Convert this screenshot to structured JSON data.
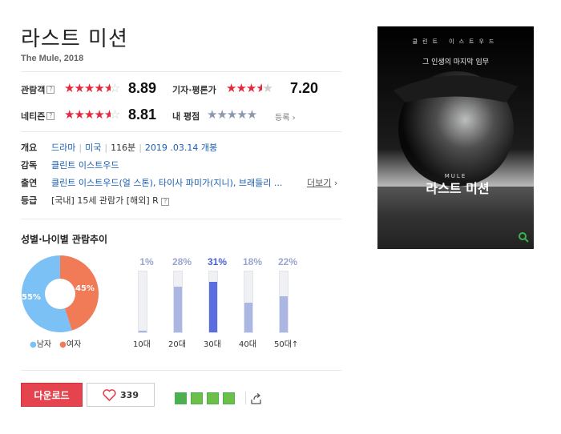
{
  "movie": {
    "title": "라스트 미션",
    "original": "The Mule, 2018"
  },
  "ratings": {
    "audience": {
      "label": "관람객",
      "score": "8.89",
      "stars": 4.5
    },
    "critics": {
      "label": "기자·평론가",
      "score": "7.20",
      "stars": 3.5
    },
    "netizen": {
      "label": "네티즌",
      "score": "8.81",
      "stars": 4.5
    },
    "mine": {
      "label": "내 평점",
      "action": "등록"
    }
  },
  "info": {
    "overview_label": "개요",
    "genre": "드라마",
    "country": "미국",
    "runtime": "116분",
    "release": "2019 .03.14 개봉",
    "director_label": "감독",
    "director": "클린트 이스트우드",
    "cast_label": "출연",
    "cast": "클린트 이스트우드(얼 스톤), 타이사 파미가(지니), 브래들리 ...",
    "more": "더보기",
    "grade_label": "등급",
    "grade": "[국내] 15세 관람가 [해외] R"
  },
  "trend": {
    "title": "성별·나이별 관람추이",
    "gender": {
      "male_pct": 55,
      "female_pct": 45,
      "male_label": "55%",
      "female_label": "45%",
      "legend_male": "남자",
      "legend_female": "여자"
    },
    "ages": [
      {
        "label": "10대",
        "pct_text": "1%",
        "value": 1
      },
      {
        "label": "20대",
        "pct_text": "28%",
        "value": 28
      },
      {
        "label": "30대",
        "pct_text": "31%",
        "value": 31,
        "highlight": true
      },
      {
        "label": "40대",
        "pct_text": "18%",
        "value": 18
      },
      {
        "label": "50대↑",
        "pct_text": "22%",
        "value": 22
      }
    ]
  },
  "actions": {
    "download": "다운로드",
    "likes": "339"
  },
  "poster": {
    "top_text": "클린트 이스트우드",
    "tagline": "그 인생의 마지막 임무",
    "en_title": "MULE",
    "ko_title": "라스트 미션"
  },
  "colors": {
    "red_star": "#e5293c",
    "male": "#7cc1f5",
    "female": "#f27b57",
    "bar": "#aab7e3",
    "bar_hi": "#5b6ee1",
    "download": "#e5444f"
  }
}
